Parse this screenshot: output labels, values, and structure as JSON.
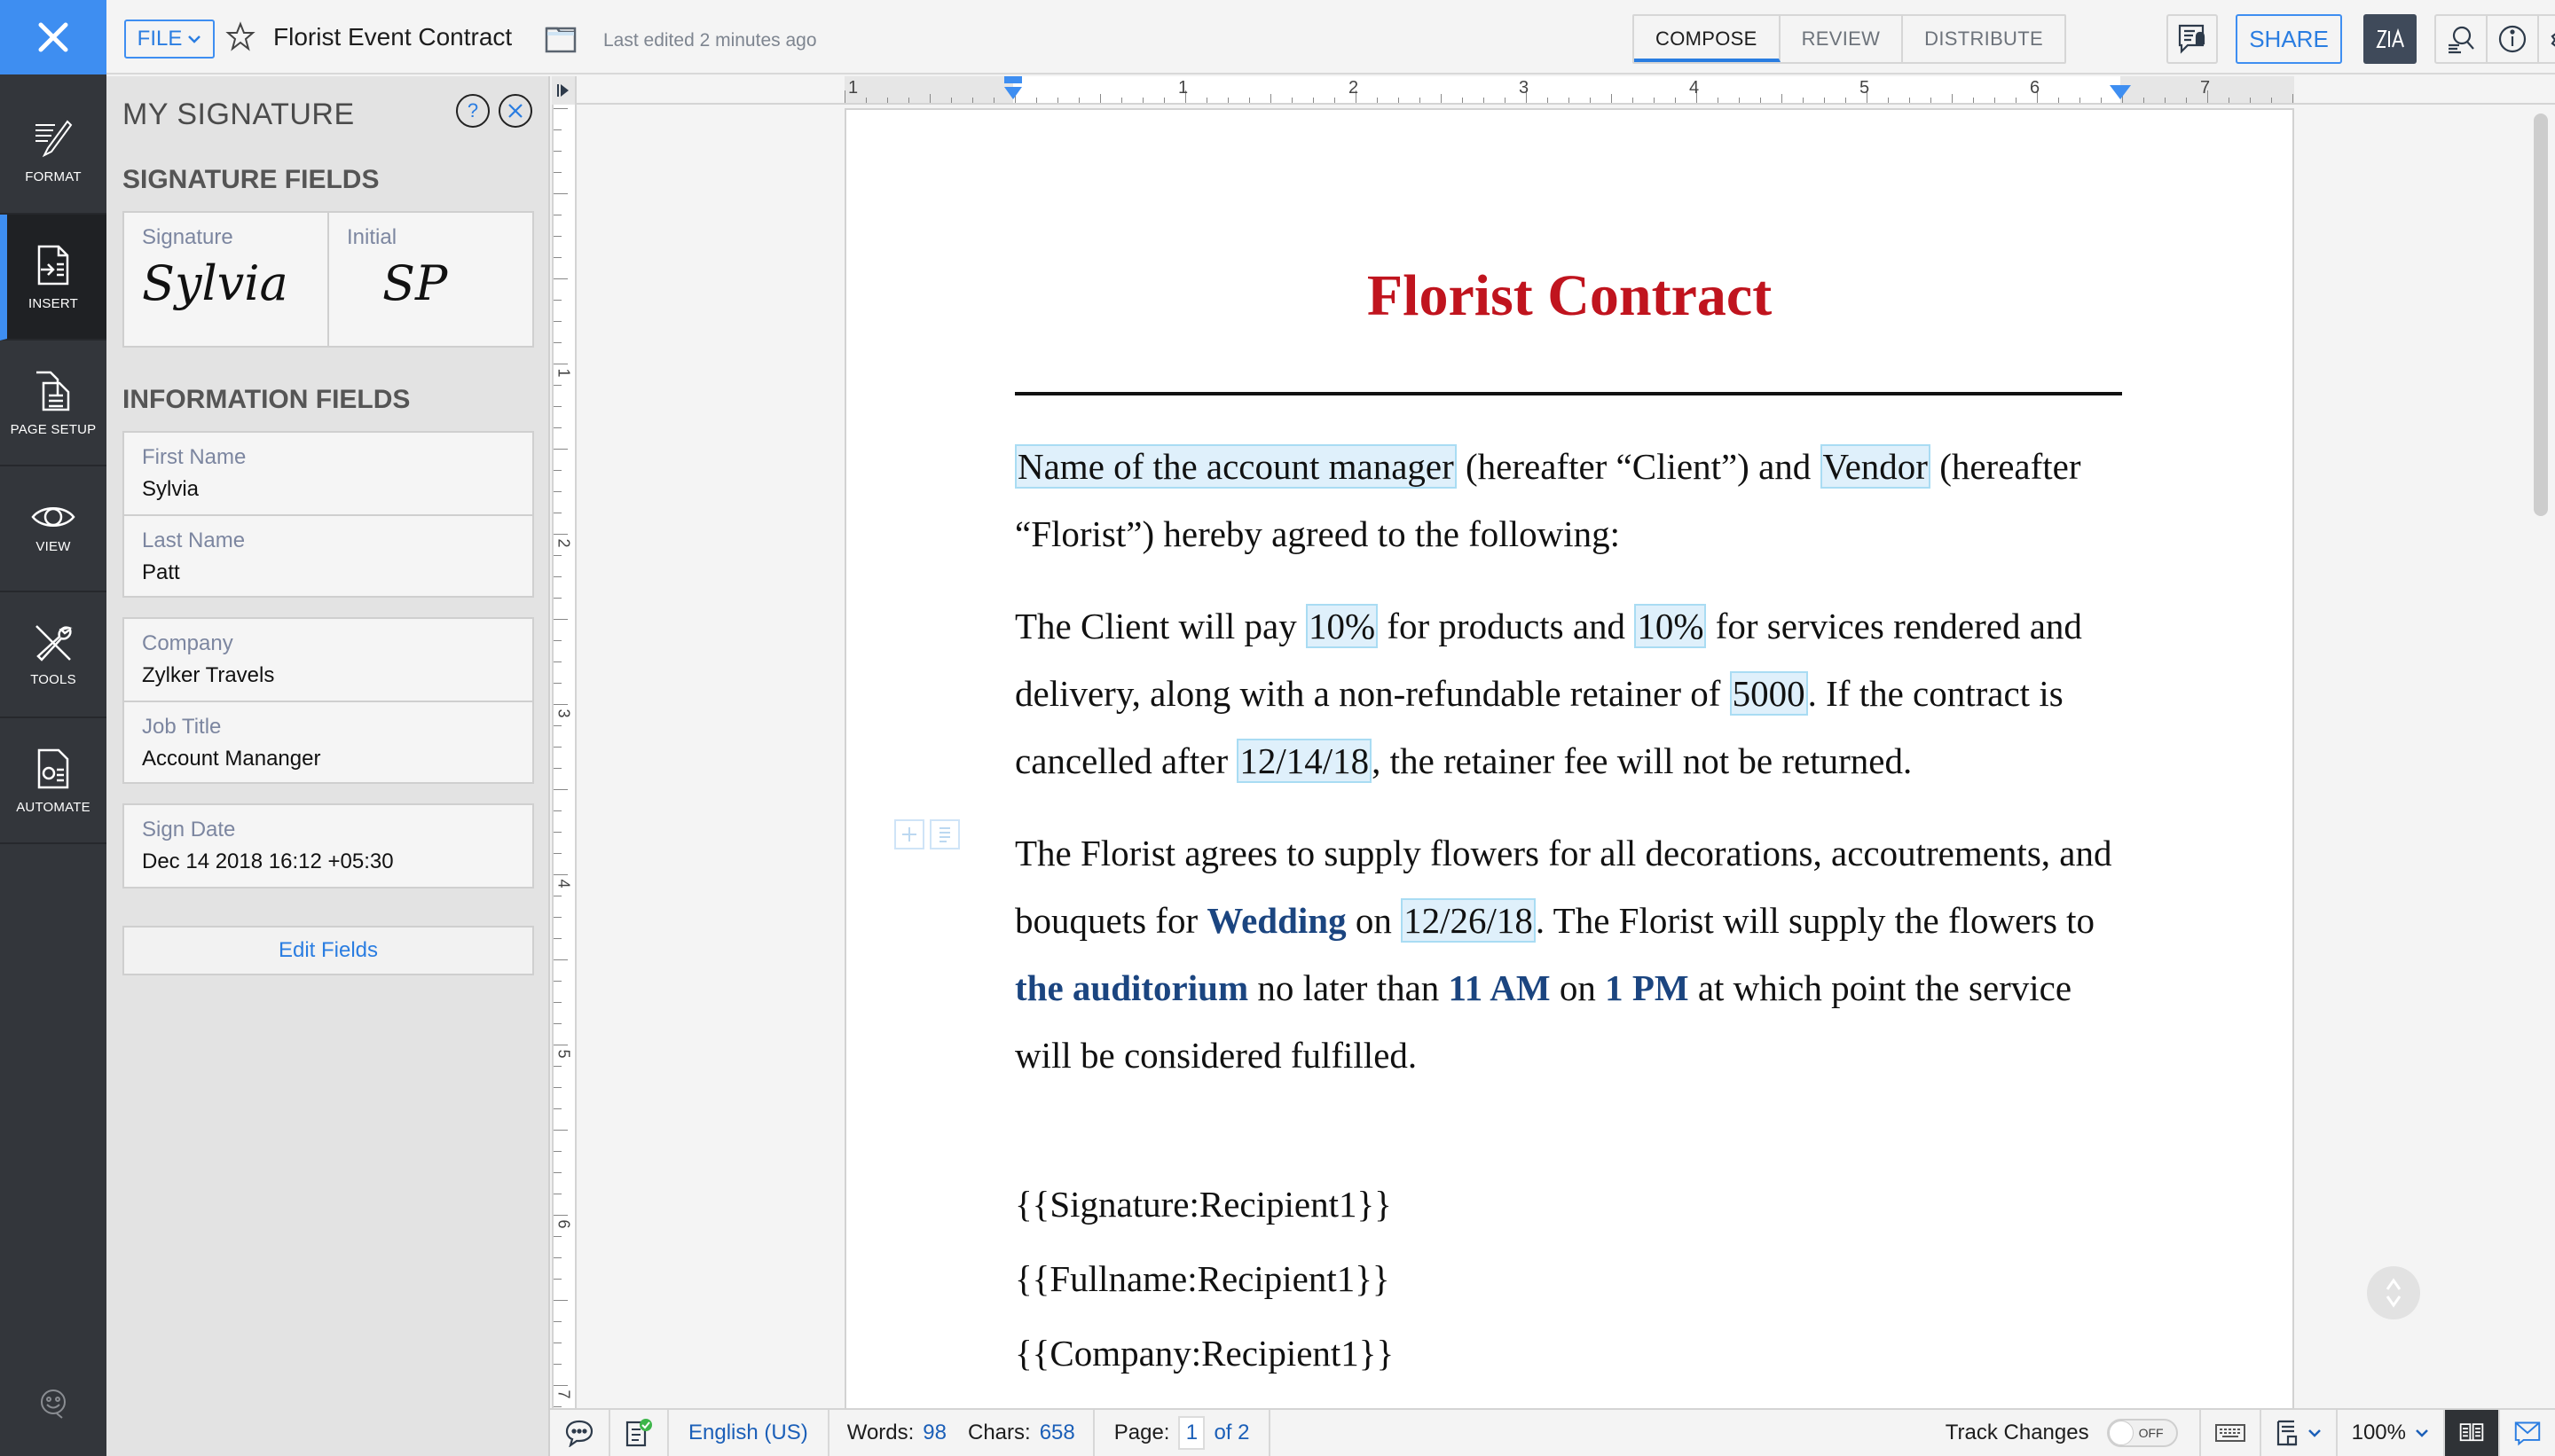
{
  "app": {
    "close_label": "Close"
  },
  "rail": {
    "items": [
      {
        "label": "FORMAT",
        "icon": "format-brush-icon"
      },
      {
        "label": "INSERT",
        "icon": "insert-document-icon",
        "active": true
      },
      {
        "label": "PAGE SETUP",
        "icon": "page-setup-icon"
      },
      {
        "label": "VIEW",
        "icon": "eye-icon"
      },
      {
        "label": "TOOLS",
        "icon": "tools-icon"
      },
      {
        "label": "AUTOMATE",
        "icon": "automate-icon"
      }
    ],
    "feedback_icon": "feedback-smiley-icon"
  },
  "header": {
    "file_label": "FILE",
    "doc_title": "Florist Event Contract",
    "last_edited": "Last edited 2 minutes ago",
    "tabs": [
      {
        "label": "COMPOSE",
        "active": true
      },
      {
        "label": "REVIEW"
      },
      {
        "label": "DISTRIBUTE"
      }
    ],
    "share_label": "SHARE"
  },
  "panel": {
    "title": "MY SIGNATURE",
    "help_label": "?",
    "signature_section": "SIGNATURE FIELDS",
    "signature": {
      "label": "Signature",
      "value": "Sylvia"
    },
    "initial": {
      "label": "Initial",
      "value": "SP"
    },
    "info_section": "INFORMATION FIELDS",
    "fields": [
      {
        "label": "First Name",
        "value": "Sylvia"
      },
      {
        "label": "Last Name",
        "value": "Patt"
      },
      {
        "label": "Company",
        "value": "Zylker Travels"
      },
      {
        "label": "Job Title",
        "value": "Account Mananger"
      },
      {
        "label": "Sign Date",
        "value": "Dec 14 2018 16:12 +05:30"
      }
    ],
    "edit_fields_label": "Edit Fields"
  },
  "ruler": {
    "h_labels": [
      "1",
      "1",
      "2",
      "3",
      "4",
      "5",
      "6",
      "7"
    ],
    "v_labels": [
      "1",
      "2",
      "3",
      "4",
      "5",
      "6",
      "7"
    ]
  },
  "document": {
    "heading": "Florist Contract",
    "p1": {
      "f1": "Name of the account manager",
      "t1": " (hereafter “Client”) and ",
      "f2": "Vendor",
      "t2": " (hereafter “Florist”) hereby agreed to the following:"
    },
    "p2": {
      "t1": "The Client will pay ",
      "f1": "10%",
      "t2": " for products and ",
      "f2": "10%",
      "t3": " for services rendered and delivery, along with a non-refundable retainer of ",
      "f3": "5000",
      "t4": ". If the contract is cancelled after ",
      "f4": "12/14/18",
      "t5": ", the retainer fee will not be returned."
    },
    "p3": {
      "t1": "The Florist agrees to supply flowers for all decorations, accoutrements, and bouquets for ",
      "b1": "Wedding",
      "t2": " on ",
      "f1": "12/26/18",
      "t3": ". The Florist will supply the flowers to ",
      "b2": "the auditorium",
      "t4": " no later than ",
      "b3": "11 AM",
      "t5": " on ",
      "b4": "1 PM",
      "t6": " at which point the service will be considered fulfilled."
    },
    "placeholders": [
      "{{Signature:Recipient1}}",
      "{{Fullname:Recipient1}}",
      "{{Company:Recipient1}}"
    ]
  },
  "status": {
    "language": "English (US)",
    "words_label": "Words:",
    "words": "98",
    "chars_label": "Chars:",
    "chars": "658",
    "page_label": "Page:",
    "page": "1",
    "page_of": "of 2",
    "track_changes_label": "Track Changes",
    "track_changes_state": "OFF",
    "zoom": "100%"
  },
  "colors": {
    "accent": "#3e8ef1",
    "heading": "#c0141e",
    "field_highlight": "#dff0fb",
    "merge_text": "#1b4580"
  }
}
